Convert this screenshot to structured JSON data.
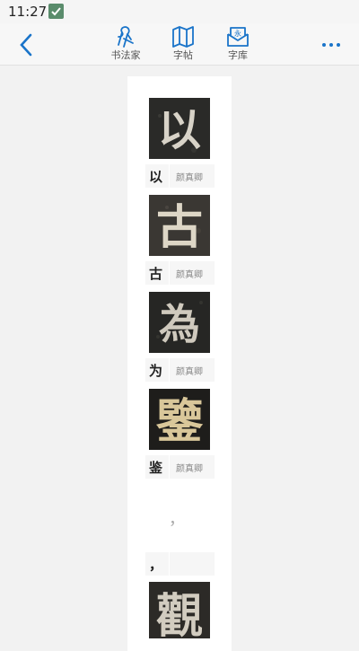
{
  "status": {
    "time": "11:27"
  },
  "nav": {
    "items": [
      {
        "label": "书法家",
        "icon": "calligrapher-icon"
      },
      {
        "label": "字帖",
        "icon": "copybook-icon"
      },
      {
        "label": "字库",
        "icon": "font-library-icon"
      }
    ]
  },
  "characters": [
    {
      "char": "以",
      "author": "颜真卿"
    },
    {
      "char": "古",
      "author": "颜真卿"
    },
    {
      "char": "为",
      "author": "颜真卿"
    },
    {
      "char": "鉴",
      "author": "颜真卿"
    },
    {
      "char": "，",
      "author": ""
    },
    {
      "char": "",
      "author": ""
    }
  ],
  "punctuation_placeholder": "，",
  "tile_glyphs": [
    "以",
    "古",
    "為",
    "鑒",
    "觀"
  ],
  "colors": {
    "accent": "#1a74c9",
    "tile_bg": "#2b2b2b",
    "glyph": "#d7d2c8"
  }
}
